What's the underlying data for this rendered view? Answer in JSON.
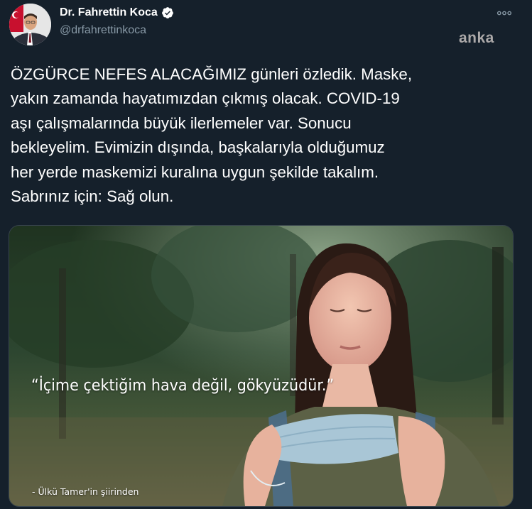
{
  "tweet": {
    "author": {
      "display_name": "Dr. Fahrettin Koca",
      "handle": "@drfahrettinkoca",
      "verified": true
    },
    "more_icon": "more-options-icon",
    "watermark": "anka",
    "text": "ÖZGÜRCE NEFES ALACAĞIMIZ günleri özledik. Maske,\nyakın zamanda hayatımızdan çıkmış olacak. COVID-19\naşı çalışmalarında büyük ilerlemeler var. Sonucu\nbekleyelim. Evimizin dışında, başkalarıyla olduğumuz\nher yerde maskemizi kuralına uygun şekilde takalım.\nSabrınız için: Sağ olun.",
    "media": {
      "quote": "“İçime çektiğim hava değil, gökyüzüdür.”",
      "credit": "- Ülkü Tamer'in şiirinden"
    }
  },
  "colors": {
    "background": "#15202b",
    "text_primary": "#ffffff",
    "text_secondary": "#8899a6",
    "verified_badge": "#ffffff",
    "border": "#38444d"
  }
}
